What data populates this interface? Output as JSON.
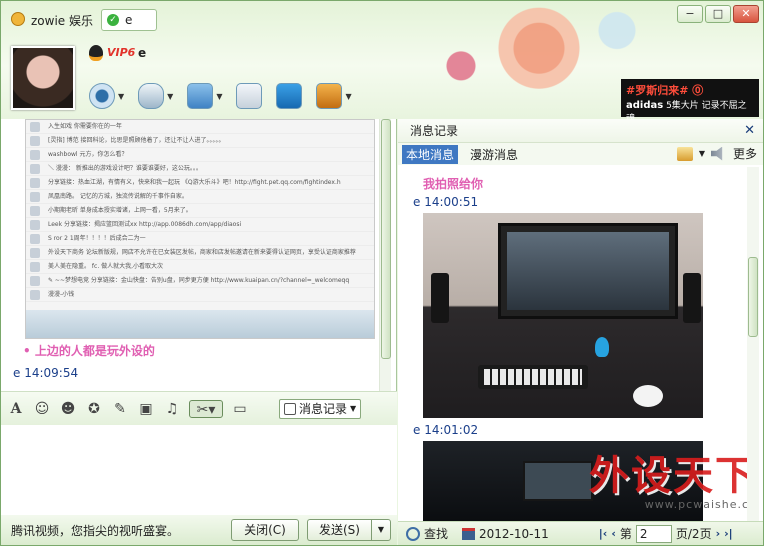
{
  "window": {
    "title": "zowie 娱乐",
    "status_text": "e",
    "controls": [
      "−",
      "□",
      "✕"
    ]
  },
  "contact": {
    "vip_badge": "VIP6",
    "name": "e"
  },
  "ad": {
    "headline": "#罗斯归来# ⓪",
    "brand": "adidas",
    "tagline": "5集大片  记录不屈之魂"
  },
  "chat": {
    "embedded_lines": [
      "入生如戏  你需要你在的一年",
      "[灵指] 博范  接回科论，比思是照顾他着了，还让不让人进了。。。。。",
      "washbowl  元方，你怎么看？",
      "＼ 漫漫：  新推出的游戏设计吧？谁要谁要好，这公玩。。。",
      "分享链接：热血江湖，有情有义，快来和我一起玩 《Q游大乐斗》吧！http://fight.pet.qq.com/fightindex.h",
      "凤凰南路。  记忆的方城，独流传说解的千事作自家。",
      "小期期老昕  单身成本授实增诸，上网一看，5月来了。",
      "Leek  分享链接：揭应篮回测试xx http://app.0086dh.com/app/diaosi",
      "S ror  2 1周年！！！！后成合二为一",
      "外设天下商务  论坛新版规，网店不允许在已女装区发帖，商家和店发帖邀请在新来要得认证网页，享受认证商家推荐",
      "美人美在隐重。  fc.  做人就大我,小看取大次",
      "✎ ~~梦想电竞  分享链接：金山快盘：告别u盘，同步更方便 http://www.kuaipan.cn/?channel=_welcomeqq",
      "漫漫-小钱"
    ],
    "messages": [
      {
        "kind": "text",
        "text": "• 上边的人都是玩外设的"
      },
      {
        "kind": "time",
        "text": "e  14:09:54"
      }
    ],
    "history_button": "消息记录",
    "tip": "腾讯视频，您指尖的视听盛宴。",
    "close_button": "关闭(C)",
    "send_button": "发送(S)",
    "send_dropdown": "▼"
  },
  "history": {
    "title": "消息记录",
    "close": "✕",
    "tabs": [
      "本地消息",
      "漫游消息"
    ],
    "more": "更多",
    "first_message": "我拍照给你",
    "entries": [
      {
        "time": "e  14:00:51"
      },
      {
        "time": "e  14:01:02"
      }
    ],
    "find": "查找",
    "date": "2012-10-11",
    "page_label": "第",
    "page_value": "2",
    "page_total": "页/2页",
    "nav_first": "|‹",
    "nav_prev": "‹",
    "nav_next": "›",
    "nav_last": "›|"
  },
  "watermark": {
    "main": "外设天下",
    "url": "www.pcwaishe.cn"
  }
}
